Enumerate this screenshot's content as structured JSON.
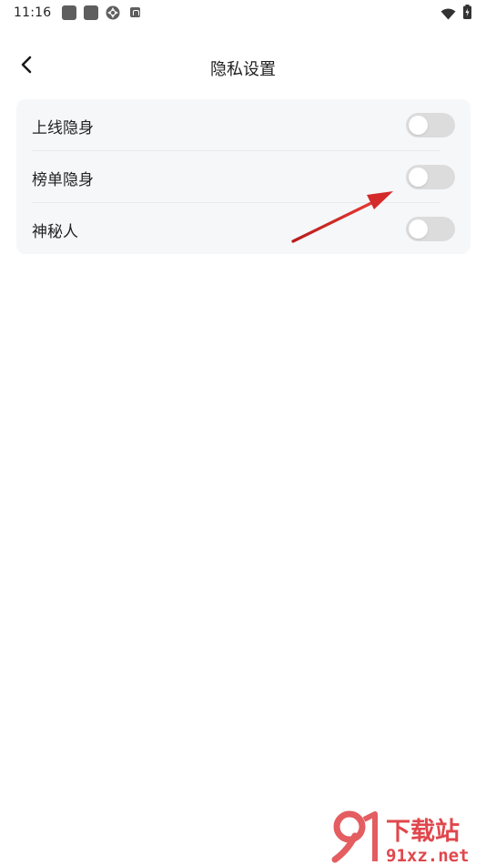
{
  "status_bar": {
    "time": "11:16",
    "icons": [
      "notification-square-icon",
      "notification-square-icon",
      "aperture-icon",
      "a-badge-icon",
      "wifi-icon",
      "battery-icon"
    ]
  },
  "header": {
    "back_icon": "chevron-left-icon",
    "title": "隐私设置"
  },
  "settings": {
    "items": [
      {
        "label": "上线隐身",
        "enabled": false
      },
      {
        "label": "榜单隐身",
        "enabled": false
      },
      {
        "label": "神秘人",
        "enabled": false
      }
    ]
  },
  "annotation": {
    "type": "red-arrow",
    "target": "榜单隐身 toggle",
    "color": "#d42a2a"
  },
  "watermark": {
    "brand": "下载站",
    "site": "91xz.net",
    "logo": "91",
    "color": "#e0474c"
  },
  "colors": {
    "background": "#ffffff",
    "card_background": "#f6f7f9",
    "toggle_off": "#dcdcdc",
    "text": "#222222"
  }
}
